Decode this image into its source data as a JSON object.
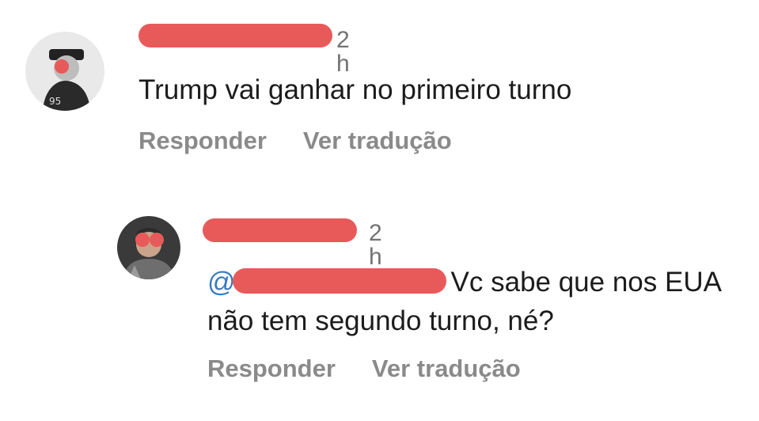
{
  "comments": [
    {
      "time": "2 h",
      "text": "Trump vai ganhar no primeiro turno",
      "reply_label": "Responder",
      "translate_label": "Ver tradução"
    },
    {
      "time": "2 h",
      "mention": "@",
      "text_line1": "Vc sabe que nos EUA",
      "text_line2": "não tem segundo turno, né?",
      "reply_label": "Responder",
      "translate_label": "Ver tradução"
    }
  ],
  "colors": {
    "redaction": "#e85a5a",
    "mention": "#3b7bbf",
    "secondary_text": "#8a8a8a"
  }
}
